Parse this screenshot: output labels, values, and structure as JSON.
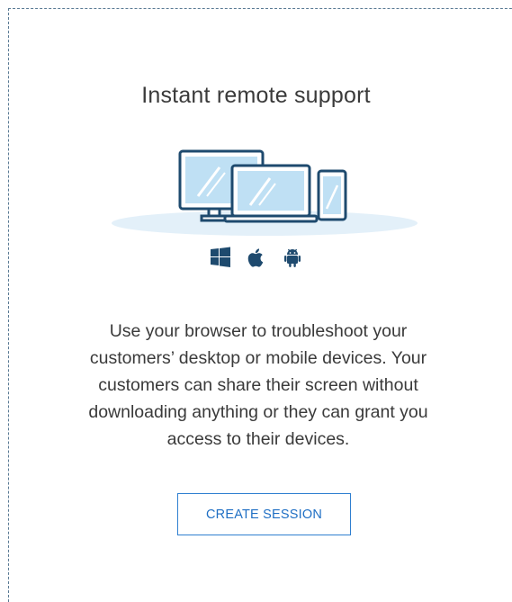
{
  "card": {
    "title": "Instant remote support",
    "description": "Use your browser to troubleshoot your customers’ desktop or mobile devices. Your customers can share their screen without downloading anything or they can grant you access to their devices.",
    "illustration": "devices-illustration",
    "os_icons": [
      "windows-icon",
      "apple-icon",
      "android-icon"
    ],
    "create_button_label": "CREATE SESSION"
  },
  "colors": {
    "accent": "#1f6fc4",
    "icon_dark": "#1e4a6e",
    "device_screen": "#bfe0f4",
    "shadow": "#e3f0f9"
  }
}
